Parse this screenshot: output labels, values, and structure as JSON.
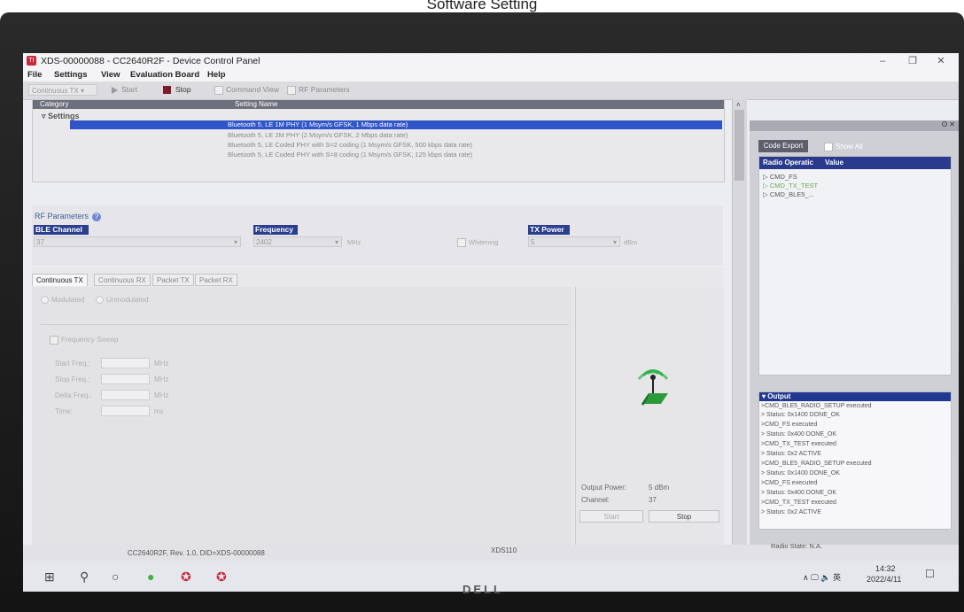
{
  "caption": "Software Setting",
  "window": {
    "title": "XDS-00000088 - CC2640R2F - Device Control Panel",
    "controls": [
      "–",
      "❐",
      "✕"
    ]
  },
  "menu": [
    "File",
    "Settings",
    "View",
    "Evaluation Board",
    "Help"
  ],
  "toolbar": {
    "mode_value": "Continuous TX",
    "start_label": "Start",
    "stop_label": "Stop",
    "command_view_label": "Command View",
    "rf_parameters_label": "RF Parameters"
  },
  "settings": {
    "col_category": "Category",
    "col_setting_name": "Setting Name",
    "group_label": "Settings",
    "rows": [
      "Bluetooth 5, LE 1M PHY (1 Msym/s GFSK, 1 Mbps data rate)",
      "Bluetooth 5, LE 2M PHY (2 Msym/s GFSK, 2 Mbps data rate)",
      "Bluetooth 5, LE Coded PHY with S=2 coding (1 Msym/s GFSK, 500 kbps data rate)",
      "Bluetooth 5, LE Coded PHY with S=8 coding (1 Msym/s GFSK, 125 kbps data rate)"
    ],
    "selected_index": 0
  },
  "rf": {
    "title": "RF Parameters",
    "ble_channel_label": "BLE Channel",
    "ble_channel_value": "37",
    "frequency_label": "Frequency",
    "frequency_value": "2402",
    "frequency_unit": "MHz",
    "whitening_label": "Whitening",
    "tx_power_label": "TX Power",
    "tx_power_value": "5",
    "tx_power_unit": "dBm"
  },
  "tabs": [
    "Continuous TX",
    "Continuous RX",
    "Packet TX",
    "Packet RX"
  ],
  "tx": {
    "modulated_label": "Modulated",
    "unmodulated_label": "Unmodulated",
    "freq_sweep_label": "Frequency Sweep",
    "start_freq_label": "Start Freq.:",
    "stop_freq_label": "Stop Freq.:",
    "delta_freq_label": "Delta Freq.:",
    "time_label": "Time:",
    "mhz": "MHz",
    "ms": "ms",
    "output_power_label": "Output Power:",
    "output_power_value": "5 dBm",
    "channel_label": "Channel:",
    "channel_value": "37",
    "start_button": "Start",
    "stop_button": "Stop"
  },
  "side": {
    "code_export": "Code Export",
    "show_all": "Show All",
    "col_radio_op": "Radio Operatic",
    "col_value": "Value",
    "ops": [
      "CMD_FS",
      "CMD_TX_TEST",
      "CMD_BLE5_..."
    ],
    "output_title": "Output",
    "output_lines": [
      ">CMD_BLE5_RADIO_SETUP executed",
      ">                    Status: 0x1400  DONE_OK",
      ">CMD_FS executed",
      ">                    Status: 0x400   DONE_OK",
      ">CMD_TX_TEST executed",
      ">                    Status: 0x2     ACTIVE",
      ">CMD_BLE5_RADIO_SETUP executed",
      ">                    Status: 0x1400  DONE_OK",
      ">CMD_FS executed",
      ">                    Status: 0x400   DONE_OK",
      ">CMD_TX_TEST executed",
      ">                    Status: 0x2     ACTIVE"
    ]
  },
  "status": {
    "device": "CC2640R2F, Rev. 1.0, DID=XDS-00000088",
    "probe": "XDS110",
    "radio_state": "Radio State: N.A."
  },
  "taskbar": {
    "time": "14:32",
    "date": "2022/4/11",
    "tray": "∧ 🖵 🔈 英"
  },
  "monitor_brand": "DELL"
}
